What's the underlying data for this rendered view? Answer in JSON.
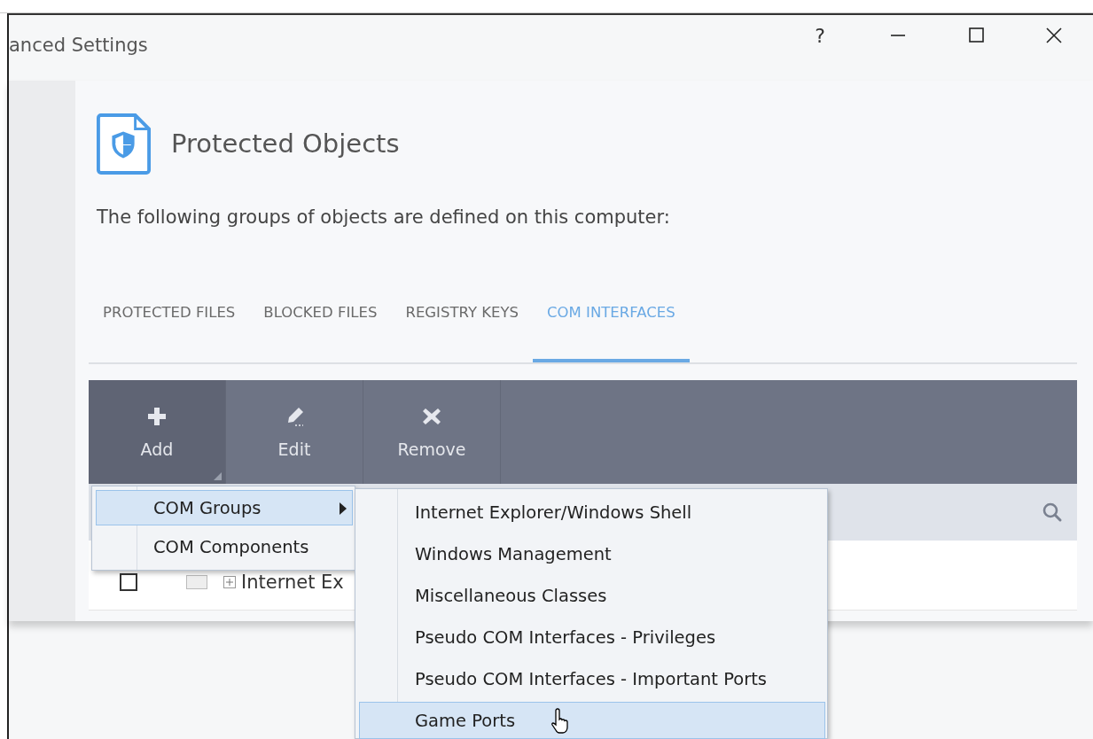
{
  "window": {
    "title": "anced Settings",
    "controls": [
      {
        "kind": "help",
        "label": "?"
      },
      {
        "kind": "minimize"
      },
      {
        "kind": "maximize"
      },
      {
        "kind": "close"
      }
    ]
  },
  "header": {
    "title": "Protected Objects",
    "description": "The following groups of objects are defined on this computer:"
  },
  "tabs": [
    {
      "label": "PROTECTED FILES",
      "selected": false
    },
    {
      "label": "BLOCKED FILES",
      "selected": false
    },
    {
      "label": "REGISTRY KEYS",
      "selected": false
    },
    {
      "label": "COM INTERFACES",
      "selected": true
    }
  ],
  "toolbar": [
    {
      "kind": "add",
      "label": "Add",
      "selected": true,
      "has_menu": true
    },
    {
      "kind": "edit",
      "label": "Edit",
      "selected": false,
      "has_menu": false
    },
    {
      "kind": "remove",
      "label": "Remove",
      "selected": false,
      "has_menu": false
    }
  ],
  "table": {
    "rows": [
      {
        "checked": false,
        "expanded": false,
        "name": "Internet Ex"
      }
    ]
  },
  "menu": {
    "items": [
      {
        "label": "COM Groups",
        "selected": true,
        "has_submenu": true
      },
      {
        "label": "COM Components",
        "selected": false,
        "has_submenu": false
      }
    ]
  },
  "submenu": {
    "items": [
      {
        "label": "Internet Explorer/Windows Shell",
        "selected": false
      },
      {
        "label": "Windows Management",
        "selected": false
      },
      {
        "label": "Miscellaneous Classes",
        "selected": false
      },
      {
        "label": "Pseudo COM Interfaces - Privileges",
        "selected": false
      },
      {
        "label": "Pseudo COM Interfaces - Important Ports",
        "selected": false
      },
      {
        "label": "Game Ports",
        "selected": true
      }
    ]
  }
}
